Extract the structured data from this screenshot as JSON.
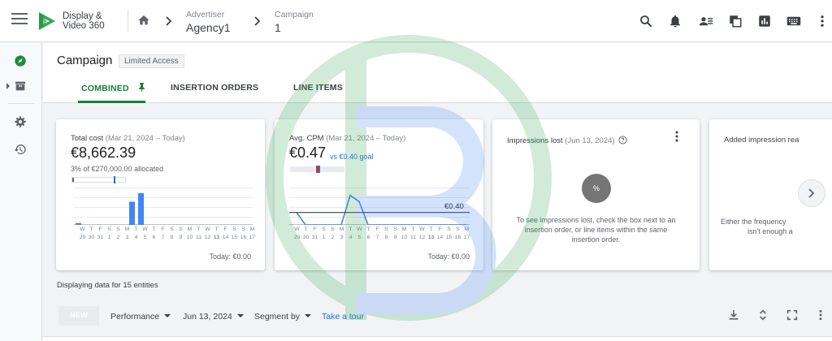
{
  "app": {
    "title_line1": "Display &",
    "title_line2": "Video 360"
  },
  "breadcrumb": [
    {
      "label": "Advertiser",
      "value": "Agency1"
    },
    {
      "label": "Campaign",
      "value": "1"
    }
  ],
  "toolbar_icons": [
    "search-icon",
    "notifications-icon",
    "users-icon",
    "copy-icon",
    "reports-icon",
    "keyboard-icon",
    "more-vert-icon"
  ],
  "rail_icons": [
    "explore-icon",
    "archive-icon",
    "settings-icon",
    "history-icon"
  ],
  "page": {
    "title": "Campaign",
    "badge": "Limited Access",
    "tabs": [
      "COMBINED",
      "INSERTION ORDERS",
      "LINE ITEMS"
    ],
    "active_tab": "COMBINED"
  },
  "cards": {
    "total_cost": {
      "label": "Total cost",
      "range": "(Mar 21, 2024 – Today)",
      "value": "€8,662.39",
      "allocation": "3% of €270,000.00 allocated",
      "today": "Today: €0.00"
    },
    "avg_cpm": {
      "label": "Avg. CPM",
      "range": "(Mar 21, 2024 – Today)",
      "value": "€0.47",
      "goal": "vs €0.40 goal",
      "goal_line_label": "€0.40",
      "today": "Today: €0.00"
    },
    "impressions_lost": {
      "label": "Impressions lost",
      "range": "(Jun 13, 2024)",
      "percent_symbol": "%",
      "message_line1": "To see impressions lost, check the box next to an",
      "message_line2": "insertion order, or line items within the same",
      "message_line3": "insertion order."
    },
    "added_reach": {
      "label": "Added impression rea",
      "message_line1": "Either the frequency",
      "message_line2": "isn't enough a"
    }
  },
  "day_letters": [
    "W",
    "T",
    "F",
    "S",
    "S",
    "M",
    "T",
    "W",
    "T",
    "F",
    "S",
    "S",
    "M",
    "T",
    "W",
    "T",
    "F",
    "S",
    "S",
    "M"
  ],
  "day_numbers": [
    "29",
    "30",
    "31",
    "1",
    "2",
    "3",
    "4",
    "5",
    "6",
    "7",
    "8",
    "9",
    "10",
    "11",
    "12",
    "13",
    "14",
    "15",
    "16",
    "17"
  ],
  "chart_data": [
    {
      "type": "bar",
      "categories": [
        "29",
        "30",
        "31",
        "1",
        "2",
        "3",
        "4",
        "5",
        "6",
        "7",
        "8",
        "9",
        "10",
        "11",
        "12",
        "13",
        "14",
        "15",
        "16",
        "17"
      ],
      "values": [
        0.05,
        0,
        0,
        0,
        0,
        0,
        0.62,
        0.85,
        0,
        0,
        0,
        0,
        0,
        0,
        0,
        0,
        0,
        0,
        0,
        0
      ],
      "ylim": [
        0,
        1
      ],
      "grid": true
    },
    {
      "type": "line",
      "categories": [
        "29",
        "30",
        "31",
        "1",
        "2",
        "3",
        "4",
        "5",
        "6",
        "7",
        "8",
        "9",
        "10",
        "11",
        "12",
        "13",
        "14",
        "15",
        "16",
        "17"
      ],
      "values": [
        0.4,
        0.0,
        0.0,
        0.0,
        0.0,
        0.0,
        0.95,
        0.75,
        0.0,
        0.0,
        0.0,
        0.0,
        0.0,
        0.0,
        0.0,
        0.0,
        0.0,
        0.0,
        0.0,
        0.0
      ],
      "goal": 0.4,
      "ylim": [
        0,
        1.2
      ],
      "grid": true
    }
  ],
  "bottom": {
    "display_note": "Displaying data for 15 entities",
    "new_button": "NEW",
    "dropdowns": [
      "Performance",
      "Jun 13, 2024",
      "Segment by"
    ],
    "tour_link": "Take a tour"
  }
}
